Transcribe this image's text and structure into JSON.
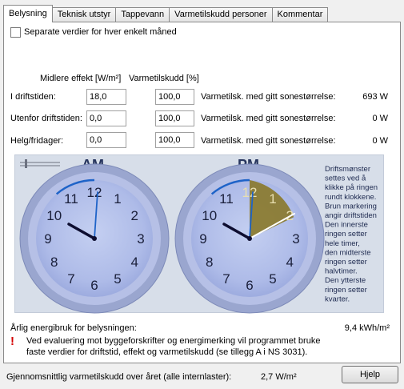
{
  "tabs": [
    {
      "label": "Belysning",
      "active": true
    },
    {
      "label": "Teknisk utstyr"
    },
    {
      "label": "Tappevann"
    },
    {
      "label": "Varmetilskudd personer"
    },
    {
      "label": "Kommentar"
    }
  ],
  "separate_label": "Separate verdier for hver enkelt måned",
  "col_headers": {
    "effekt": "Midlere effekt [W/m²]",
    "varme": "Varmetilskudd [%]"
  },
  "rows": [
    {
      "label": "I driftstiden:",
      "effekt": "18,0",
      "varme": "100,0",
      "result_label": "Varmetilsk. med gitt sonestørrelse:",
      "result_value": "693 W"
    },
    {
      "label": "Utenfor driftstiden:",
      "effekt": "0,0",
      "varme": "100,0",
      "result_label": "Varmetilsk. med gitt sonestørrelse:",
      "result_value": "0 W"
    },
    {
      "label": "Helg/fridager:",
      "effekt": "0,0",
      "varme": "100,0",
      "result_label": "Varmetilsk. med gitt sonestørrelse:",
      "result_value": "0 W"
    }
  ],
  "clocks": {
    "am_label": "AM",
    "pm_label": "PM",
    "numbers": [
      "12",
      "1",
      "2",
      "3",
      "4",
      "5",
      "6",
      "7",
      "8",
      "9",
      "10",
      "11"
    ],
    "help_text": [
      "Driftsmønster",
      "settes ved å",
      "klikke på ringen",
      "rundt klokkene.",
      "Brun markering",
      "angir driftstiden",
      "Den innerste",
      "ringen setter",
      "hele timer,",
      "den midterste",
      "ringen setter",
      "halvtimer.",
      "Den ytterste",
      "ringen setter",
      "kvarter."
    ],
    "accent": "#1e63c8",
    "marking_color": "#8a7a2c"
  },
  "annual_label": "Årlig energibruk for belysningen:",
  "annual_value": "9,4 kWh/m²",
  "warning_icon": "!",
  "warning_text": [
    "Ved evaluering mot byggeforskrifter og energimerking vil programmet bruke",
    "faste verdier for driftstid, effekt og varmetilskudd (se tillegg A i NS 3031)."
  ],
  "footer_label": "Gjennomsnittlig varmetilskudd over året (alle internlaster):",
  "footer_value": "2,7 W/m²",
  "help_button": "Hjelp"
}
